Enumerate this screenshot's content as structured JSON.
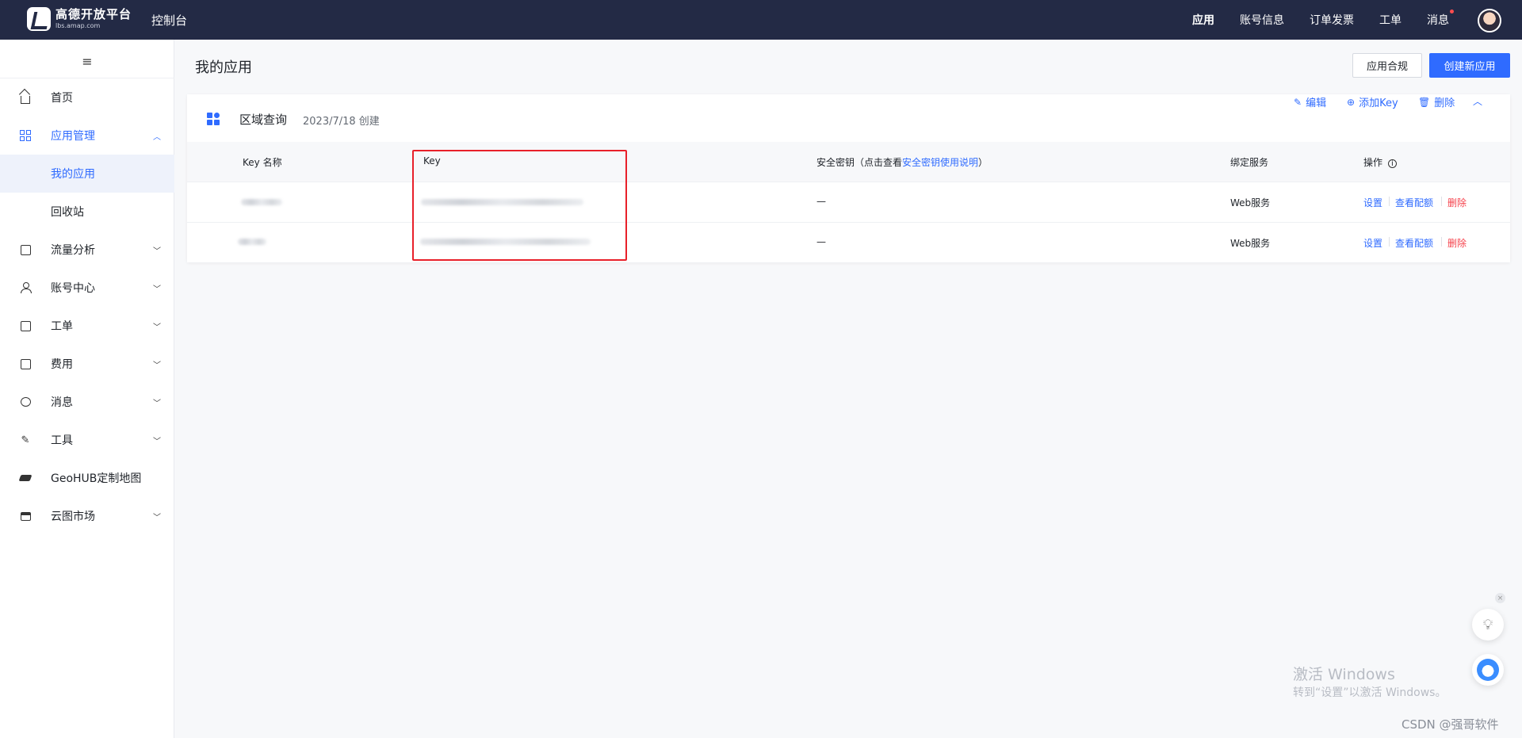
{
  "topbar": {
    "logo_cn": "高德开放平台",
    "logo_en": "lbs.amap.com",
    "console": "控制台",
    "nav": [
      {
        "label": "应用",
        "has_dot": false
      },
      {
        "label": "账号信息",
        "has_dot": false
      },
      {
        "label": "订单发票",
        "has_dot": false
      },
      {
        "label": "工单",
        "has_dot": false
      },
      {
        "label": "消息",
        "has_dot": true
      }
    ]
  },
  "sidebar": {
    "menu_icon": "≡",
    "items": [
      {
        "label": "首页",
        "icon": "home-icon",
        "expandable": false
      },
      {
        "label": "应用管理",
        "icon": "grid-icon",
        "expandable": true,
        "expanded": true,
        "children": [
          {
            "label": "我的应用",
            "active": true
          },
          {
            "label": "回收站",
            "active": false
          }
        ]
      },
      {
        "label": "流量分析",
        "icon": "chart-icon",
        "expandable": true
      },
      {
        "label": "账号中心",
        "icon": "person-icon",
        "expandable": true
      },
      {
        "label": "工单",
        "icon": "ticket-icon",
        "expandable": true
      },
      {
        "label": "费用",
        "icon": "fee-icon",
        "expandable": true
      },
      {
        "label": "消息",
        "icon": "message-icon",
        "expandable": true
      },
      {
        "label": "工具",
        "icon": "wrench-icon",
        "expandable": true
      },
      {
        "label": "GeoHUB定制地图",
        "icon": "layers-icon",
        "expandable": false
      },
      {
        "label": "云图市场",
        "icon": "store-icon",
        "expandable": true
      }
    ]
  },
  "main": {
    "title": "我的应用",
    "compliance_button": "应用合规",
    "create_button": "创建新应用",
    "app_card": {
      "name": "区域查询",
      "created": "2023/7/18 创建",
      "actions": {
        "edit": "编辑",
        "add_key": "添加Key",
        "delete": "删除"
      },
      "table": {
        "headers": {
          "key_name": "Key 名称",
          "key": "Key",
          "secret_prefix": "安全密钥（点击查看",
          "secret_link": "安全密钥使用说明",
          "secret_suffix": "）",
          "service": "绑定服务",
          "ops": "操作"
        },
        "rows": [
          {
            "secret": "—",
            "service": "Web服务",
            "op_settings": "设置",
            "op_quota": "查看配额",
            "op_delete": "删除"
          },
          {
            "secret": "—",
            "service": "Web服务",
            "op_settings": "设置",
            "op_quota": "查看配额",
            "op_delete": "删除"
          }
        ]
      }
    }
  },
  "overlay": {
    "windows_title": "激活 Windows",
    "windows_sub": "转到“设置”以激活 Windows。",
    "csdn": "CSDN @强哥软件",
    "close_glyph": "×"
  },
  "colors": {
    "accent": "#2f6bff",
    "topbar": "#232a45",
    "danger": "#f5424c",
    "highlight": "#e8202a"
  }
}
